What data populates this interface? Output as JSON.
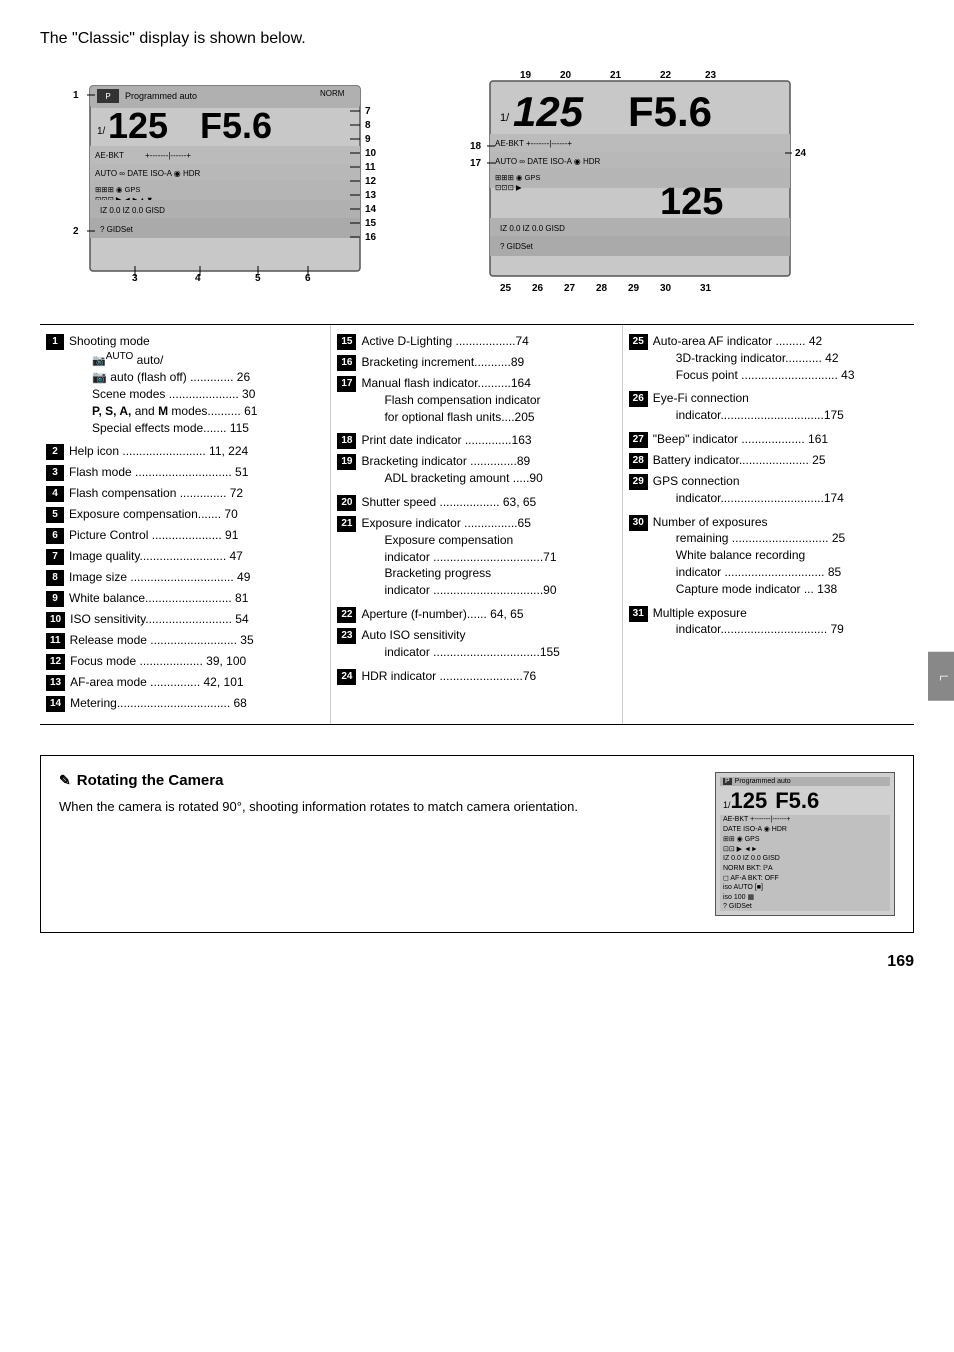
{
  "page": {
    "intro": "The \"Classic\" display is shown below.",
    "page_number": "169"
  },
  "diagram": {
    "left_labels": [
      "1",
      "2",
      "3",
      "4",
      "5",
      "6",
      "7",
      "8",
      "9",
      "10",
      "11",
      "12",
      "13",
      "14",
      "15",
      "16"
    ],
    "right_labels": [
      "17",
      "18",
      "19",
      "20",
      "21",
      "22",
      "23",
      "24",
      "25",
      "26",
      "27",
      "28",
      "29",
      "30",
      "31"
    ],
    "cam_mode": "Programmed auto",
    "cam_shutter": "125",
    "cam_shutter_prefix": "1/",
    "cam_aperture": "F5.6",
    "cam_shutter2": "125",
    "cam_aperture2": "F5.6"
  },
  "items": [
    {
      "num": "1",
      "text": "Shooting mode",
      "sub": [
        "auto/",
        "auto (flash off) ............. 26",
        "Scene modes ..................... 30",
        "P, S, A, and M modes.......... 61",
        "Special effects mode....... 115"
      ]
    },
    {
      "num": "2",
      "text": "Help icon ......................... 11, 224"
    },
    {
      "num": "3",
      "text": "Flash mode ............................ 51"
    },
    {
      "num": "4",
      "text": "Flash compensation .............. 72"
    },
    {
      "num": "5",
      "text": "Exposure compensation....... 70"
    },
    {
      "num": "6",
      "text": "Picture Control  ..................... 91"
    },
    {
      "num": "7",
      "text": "Image quality.......................... 47"
    },
    {
      "num": "8",
      "text": "Image size ............................... 49"
    },
    {
      "num": "9",
      "text": "White balance.......................... 81"
    },
    {
      "num": "10",
      "text": "ISO sensitivity.......................... 54"
    },
    {
      "num": "11",
      "text": "Release mode .......................... 35"
    },
    {
      "num": "12",
      "text": "Focus mode ................... 39, 100"
    },
    {
      "num": "13",
      "text": "AF-area mode ............... 42, 101"
    },
    {
      "num": "14",
      "text": "Metering.................................. 68"
    }
  ],
  "items_mid": [
    {
      "num": "15",
      "text": "Active D-Lighting ..................74"
    },
    {
      "num": "16",
      "text": "Bracketing increment...........89"
    },
    {
      "num": "17",
      "text": "Manual flash indicator..........164",
      "sub": [
        "Flash compensation indicator",
        "for optional flash units....205"
      ]
    },
    {
      "num": "18",
      "text": "Print date indicator ..............163"
    },
    {
      "num": "19",
      "text": "Bracketing indicator ..............89",
      "sub": [
        "ADL bracketing amount  .....90"
      ]
    },
    {
      "num": "20",
      "text": "Shutter speed .................. 63, 65"
    },
    {
      "num": "21",
      "text": "Exposure indicator ................65",
      "sub": [
        "Exposure compensation",
        "indicator .................................71",
        "Bracketing progress",
        "indicator .................................90"
      ]
    },
    {
      "num": "22",
      "text": "Aperture (f-number)...... 64, 65"
    },
    {
      "num": "23",
      "text": "Auto ISO sensitivity",
      "sub": [
        "indicator ................................155"
      ]
    },
    {
      "num": "24",
      "text": "HDR indicator .........................76"
    }
  ],
  "items_right": [
    {
      "num": "25",
      "text": "Auto-area AF indicator ......... 42",
      "sub": [
        "3D-tracking indicator........... 42",
        "Focus point ............................. 43"
      ]
    },
    {
      "num": "26",
      "text": "Eye-Fi connection",
      "sub": [
        "indicator...............................175"
      ]
    },
    {
      "num": "27",
      "text": "\"Beep\" indicator ................... 161"
    },
    {
      "num": "28",
      "text": "Battery indicator..................... 25"
    },
    {
      "num": "29",
      "text": "GPS connection",
      "sub": [
        "indicator...............................174"
      ]
    },
    {
      "num": "30",
      "text": "Number of exposures",
      "sub": [
        "remaining ............................. 25",
        "White balance recording",
        "indicator .............................. 85",
        "Capture mode indicator ... 138"
      ]
    },
    {
      "num": "31",
      "text": "Multiple exposure",
      "sub": [
        "indicator................................ 79"
      ]
    }
  ],
  "note": {
    "title": "Rotating the Camera",
    "icon": "✎",
    "text": "When the camera is rotated 90°, shooting information rotates to match camera orientation."
  }
}
